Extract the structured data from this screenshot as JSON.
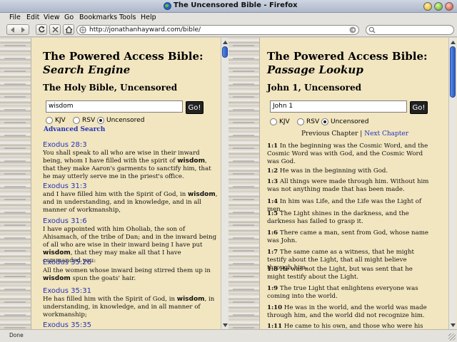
{
  "window": {
    "title": "The Uncensored Bible - Firefox"
  },
  "menu": [
    "File",
    "Edit",
    "View",
    "Go",
    "Bookmarks",
    "Tools",
    "Help"
  ],
  "toolbar": {
    "url": "http://jonathanhayward.com/bible/",
    "search_placeholder": ""
  },
  "left": {
    "title_line1": "The Powered Access Bible:",
    "title_line2": "Search Engine",
    "subtitle": "The Holy Bible, Uncensored",
    "query": "wisdom",
    "go_label": "Go!",
    "versions": [
      "KJV",
      "RSV",
      "Uncensored"
    ],
    "selected_version": "Uncensored",
    "advanced": "Advanced Search",
    "results": [
      {
        "ref": "Exodus 28:3",
        "before": "You shall speak to all who are wise in their inward being, whom I have filled with the spirit of ",
        "match": "wisdom",
        "after": ", that they make Aaron's garments to sanctify him, that he may utterly serve me in the priest's office."
      },
      {
        "ref": "Exodus 31:3",
        "before": "and I have filled him with the Spirit of God, in ",
        "match": "wisdom",
        "after": ", and in understanding, and in knowledge, and in all manner of workmanship,"
      },
      {
        "ref": "Exodus 31:6",
        "before": "I have appointed with him Oholiab, the son of Ahisamach, of the tribe of Dan; and in the inward being of all who are wise in their inward being I have put ",
        "match": "wisdom",
        "after": ", that they may make all that I have commanded you:"
      },
      {
        "ref": "Exodus 35:26",
        "before": "All the women whose inward being stirred them up in ",
        "match": "wisdom",
        "after": " spun the goats' hair."
      },
      {
        "ref": "Exodus 35:31",
        "before": "He has filled him with the Spirit of God, in ",
        "match": "wisdom",
        "after": ", in understanding, in knowledge, and in all manner of workmanship;"
      },
      {
        "ref": "Exodus 35:35",
        "before": "",
        "match": "",
        "after": ""
      }
    ]
  },
  "right": {
    "title_line1": "The Powered Access Bible:",
    "title_line2": "Passage Lookup",
    "subtitle": "John 1, Uncensored",
    "query": "John 1",
    "go_label": "Go!",
    "versions": [
      "KJV",
      "RSV",
      "Uncensored"
    ],
    "selected_version": "Uncensored",
    "prev": "Previous Chapter",
    "sep": "|",
    "next": "Next Chapter",
    "verses": [
      {
        "num": "1:1",
        "text": "In the beginning was the Cosmic Word, and the Cosmic Word was with God, and the Cosmic Word was God."
      },
      {
        "num": "1:2",
        "text": "He was in the beginning with God."
      },
      {
        "num": "1:3",
        "text": "All things were made through him. Without him was not anything made that has been made."
      },
      {
        "num": "1:4",
        "text": "In him was Life, and the Life was the Light of men."
      },
      {
        "num": "1:5",
        "text": "The Light shines in the darkness, and the darkness has failed to grasp it."
      },
      {
        "num": "1:6",
        "text": "There came a man, sent from God, whose name was John."
      },
      {
        "num": "1:7",
        "text": "The same came as a witness, that he might testify about the Light, that all might believe through him."
      },
      {
        "num": "1:8",
        "text": "He was not the Light, but was sent that he might testify about the Light."
      },
      {
        "num": "1:9",
        "text": "The true Light that enlightens everyone was coming into the world."
      },
      {
        "num": "1:10",
        "text": "He was in the world, and the world was made through him, and the world did not recognize him."
      },
      {
        "num": "1:11",
        "text": "He came to his own, and those who were his own did"
      }
    ]
  },
  "status": "Done",
  "colors": {
    "link": "#2233bb",
    "paper": "#f2e6c0",
    "scroll_thumb": "#2a5ac6"
  }
}
